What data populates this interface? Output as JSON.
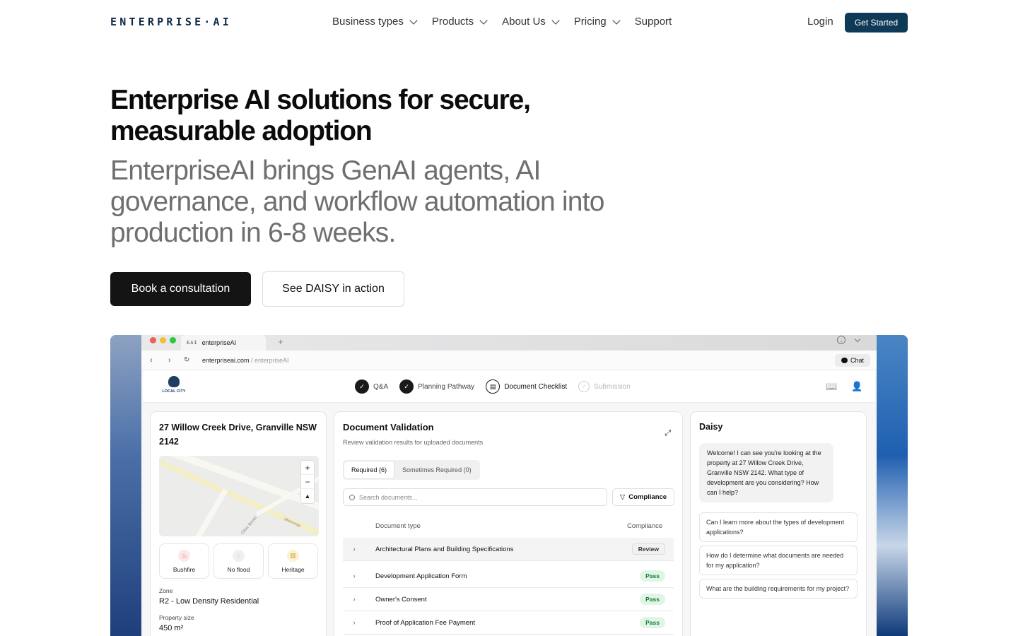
{
  "nav": {
    "logo": "ENTERPRISE·AI",
    "links": [
      "Business types",
      "Products",
      "About Us",
      "Pricing",
      "Support"
    ],
    "login": "Login",
    "cta": "Get Started"
  },
  "hero": {
    "title": "Enterprise AI solutions for secure, measurable adoption",
    "subtitle": "EnterpriseAI brings GenAI agents, AI governance, and workflow automation into production in 6-8 weeks.",
    "primary_button": "Book a consultation",
    "secondary_button": "See DAISY in action"
  },
  "browser": {
    "tab_logo": "EAI",
    "tab_title": "enterpriseAI",
    "url_host": "enterpriseai.com",
    "url_path": " / enterpriseAI",
    "chat_label": "Chat"
  },
  "app": {
    "crest_label": "LOCAL CITY",
    "steps": [
      {
        "label": "Q&A",
        "state": "done"
      },
      {
        "label": "Planning Pathway",
        "state": "done"
      },
      {
        "label": "Document Checklist",
        "state": "active"
      },
      {
        "label": "Submission",
        "state": "pending"
      }
    ],
    "property": {
      "address": "27 Willow Creek Drive, Granville NSW 2142",
      "map_streets": [
        "Memorial",
        "Olive Street"
      ],
      "tags": [
        {
          "label": "Bushfire",
          "icon": "flame-icon",
          "color": "#e04646"
        },
        {
          "label": "No flood",
          "icon": "water-icon",
          "color": "#888888"
        },
        {
          "label": "Heritage",
          "icon": "building-icon",
          "color": "#d4a21f"
        }
      ],
      "zone_label": "Zone",
      "zone_value": "R2 - Low Density Residential",
      "size_label": "Property size",
      "size_value": "450 m²"
    },
    "validation": {
      "title": "Document Validation",
      "subtitle": "Review validation results for uploaded documents",
      "tabs": [
        "Required (6)",
        "Sometimes Required (0)"
      ],
      "search_placeholder": "Search documents...",
      "filter_label": "Compliance",
      "col_doc": "Document type",
      "col_compliance": "Compliance",
      "rows": [
        {
          "name": "Architectural Plans and Building Specifications",
          "status": "Review"
        },
        {
          "name": "Development Application Form",
          "status": "Pass"
        },
        {
          "name": "Owner's Consent",
          "status": "Pass"
        },
        {
          "name": "Proof of Application Fee Payment",
          "status": "Pass"
        }
      ]
    },
    "daisy": {
      "title": "Daisy",
      "welcome": "Welcome! I can see you're looking at the property at 27 Willow Creek Drive, Granville NSW 2142. What type of development are you considering? How can I help?",
      "suggestions": [
        "Can I learn more about the types of development applications?",
        "How do I determine what documents are needed for my application?",
        "What are the building requirements for my project?"
      ]
    }
  },
  "colors": {
    "brand": "#0f3a57",
    "primary_button": "#141414",
    "pass_bg": "#dff5e5",
    "pass_text": "#1b7a3a"
  }
}
